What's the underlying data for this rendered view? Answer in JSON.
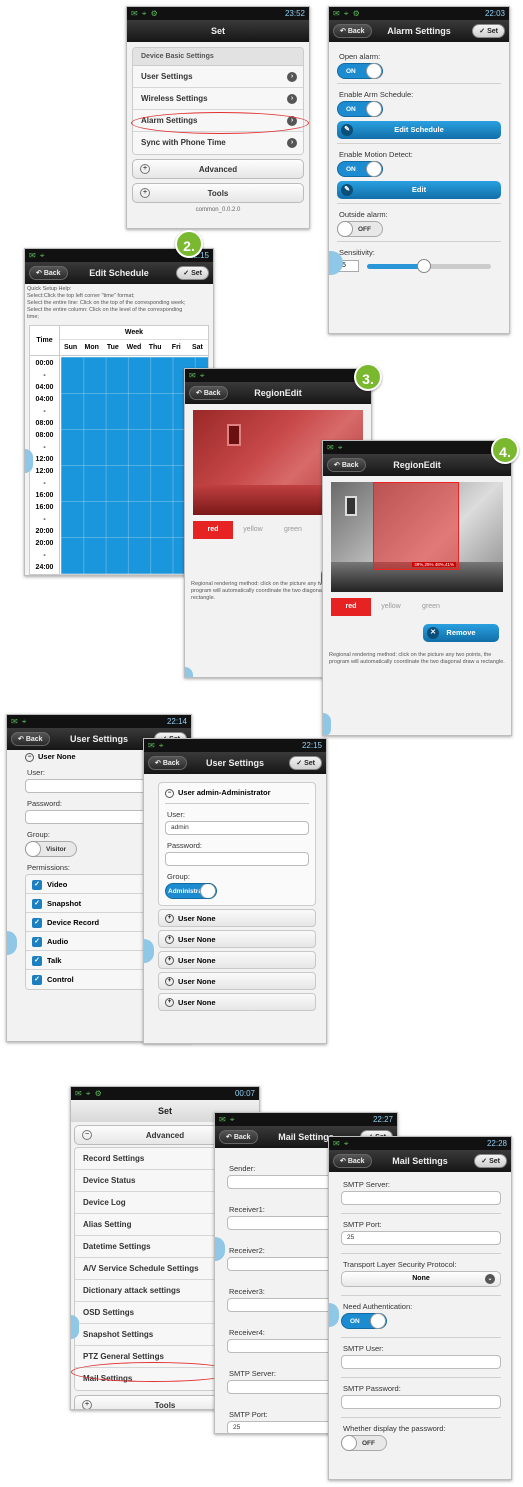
{
  "status": {
    "t1": "23:52",
    "t2": "22:03",
    "t3": "22:15",
    "t4": "22:14",
    "t5": "22:15",
    "t6": "00:07",
    "t7": "22:27",
    "t8": "22:28",
    "t9": "22",
    "t10": "22",
    "t11": "22"
  },
  "nav": {
    "back": "Back",
    "set": "Set"
  },
  "set_screen": {
    "title": "Set",
    "header": "Device Basic Settings",
    "items": [
      "User Settings",
      "Wireless Settings",
      "Alarm Settings",
      "Sync with Phone Time"
    ],
    "advanced": "Advanced",
    "tools": "Tools",
    "version": "common_0.0.2.0"
  },
  "alarm": {
    "title": "Alarm Settings",
    "open_alarm": "Open alarm:",
    "on": "ON",
    "off": "OFF",
    "arm_schedule": "Enable Arm Schedule:",
    "edit_schedule": "Edit Schedule",
    "motion": "Enable Motion Detect:",
    "edit": "Edit",
    "outside": "Outside alarm:",
    "sensitivity": "Sensitivity:",
    "sens_value": "5"
  },
  "badges": {
    "b2": "2.",
    "b3": "3.",
    "b4": "4."
  },
  "schedule": {
    "title": "Edit Schedule",
    "help": [
      "Quick Setup Help:",
      "Select:Click the top left corner \"time\" format;",
      "Select the entire line: Click on the top of the corresponding week;",
      "Select the entire column: Click on the level of the corresponding",
      "time;"
    ],
    "time": "Time",
    "week": "Week",
    "days": [
      "Sun",
      "Mon",
      "Tue",
      "Wed",
      "Thu",
      "Fri",
      "Sat"
    ],
    "times": [
      "00:00",
      "-",
      "04:00",
      "04:00",
      "-",
      "08:00",
      "08:00",
      "-",
      "12:00",
      "12:00",
      "-",
      "16:00",
      "16:00",
      "-",
      "20:00",
      "20:00",
      "-",
      "24:00"
    ]
  },
  "region": {
    "title": "RegionEdit",
    "colors": [
      "red",
      "yellow",
      "green"
    ],
    "remove": "Remove",
    "overlay": "39%,25%  48%,41%",
    "help": "Regional rendering method: click on the picture any two points, the program will automatically coordinate the two diagonal draw a rectangle."
  },
  "user1": {
    "title": "User Settings",
    "user_none": "User  None",
    "user": "User:",
    "password": "Password:",
    "group": "Group:",
    "visitor": "Visitor",
    "permissions": "Permissions:",
    "perms": [
      "Video",
      "Snapshot",
      "Device Record",
      "Audio",
      "Talk",
      "Control"
    ]
  },
  "user2": {
    "title": "User Settings",
    "user_admin": "User  admin-Administrator",
    "user": "User:",
    "user_val": "admin",
    "password": "Password:",
    "group": "Group:",
    "admin": "Administrator",
    "none_rows": [
      "User  None",
      "User  None",
      "User  None",
      "User  None",
      "User  None"
    ]
  },
  "advanced": {
    "title": "Set",
    "advanced": "Advanced",
    "items": [
      "Record Settings",
      "Device Status",
      "Device Log",
      "Alias Setting",
      "Datetime Settings",
      "A/V Service Schedule Settings",
      "Dictionary attack settings",
      "OSD Settings",
      "Snapshot Settings",
      "PTZ General Settings",
      "Mail Settings"
    ],
    "tools": "Tools"
  },
  "mail1": {
    "title": "Mail Settings",
    "fields": [
      "Sender:",
      "Receiver1:",
      "Receiver2:",
      "Receiver3:",
      "Receiver4:",
      "SMTP Server:",
      "SMTP Port:"
    ],
    "port_val": "25"
  },
  "mail2": {
    "title": "Mail Settings",
    "smtp_server": "SMTP Server:",
    "smtp_port": "SMTP Port:",
    "port_val": "25",
    "tls": "Transport Layer Security Protocol:",
    "tls_val": "None",
    "need_auth": "Need Authentication:",
    "on": "ON",
    "smtp_user": "SMTP User:",
    "smtp_pass": "SMTP Password:",
    "display_pass": "Whether display the password:",
    "off": "OFF"
  }
}
